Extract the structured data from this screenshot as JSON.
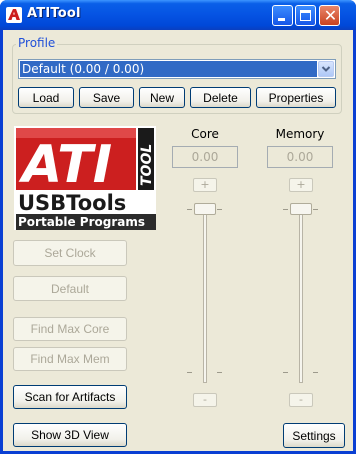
{
  "window": {
    "title": "ATITool",
    "minimize_icon": "minimize-icon",
    "maximize_icon": "maximize-icon",
    "close_icon": "close-icon"
  },
  "profile": {
    "group_label": "Profile",
    "selected": "Default (0.00 / 0.00)",
    "buttons": {
      "load": "Load",
      "save": "Save",
      "new": "New",
      "delete": "Delete",
      "properties": "Properties"
    }
  },
  "logo": {
    "brand": "ATI",
    "tool": "TOOL",
    "usbtools": "USBTools",
    "portable": "Portable Programs"
  },
  "left_buttons": {
    "set_clock": "Set Clock",
    "default": "Default",
    "find_max_core": "Find Max Core",
    "find_max_mem": "Find Max Mem",
    "scan_artifacts": "Scan for Artifacts",
    "show_3d": "Show 3D View"
  },
  "core": {
    "label": "Core",
    "value": "0.00",
    "plus": "+",
    "minus": "-"
  },
  "memory": {
    "label": "Memory",
    "value": "0.00",
    "plus": "+",
    "minus": "-"
  },
  "settings_label": "Settings",
  "colors": {
    "titlebar": "#0553e3",
    "face": "#ece9d8",
    "selection": "#316ac5",
    "group_label": "#2050d8",
    "logo_red": "#cc1f1f"
  }
}
